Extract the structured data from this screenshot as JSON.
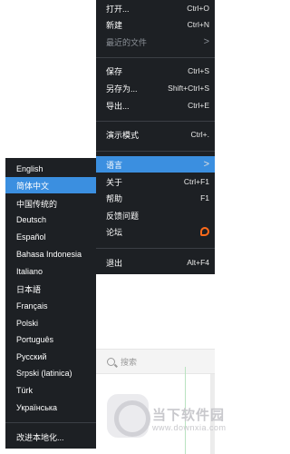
{
  "menu": {
    "items": [
      {
        "label": "打开...",
        "shortcut": "Ctrl+O"
      },
      {
        "label": "新建",
        "shortcut": "Ctrl+N"
      },
      {
        "label": "最近的文件",
        "shortcut": ">"
      },
      {
        "label": "保存",
        "shortcut": "Ctrl+S"
      },
      {
        "label": "另存为...",
        "shortcut": "Shift+Ctrl+S"
      },
      {
        "label": "导出...",
        "shortcut": "Ctrl+E"
      },
      {
        "label": "演示模式",
        "shortcut": "Ctrl+."
      },
      {
        "label": "语言",
        "shortcut": ">"
      },
      {
        "label": "关于",
        "shortcut": "Ctrl+F1"
      },
      {
        "label": "帮助",
        "shortcut": "F1"
      },
      {
        "label": "反馈问题",
        "shortcut": ""
      },
      {
        "label": "论坛",
        "shortcut": ""
      },
      {
        "label": "退出",
        "shortcut": "Alt+F4"
      }
    ]
  },
  "languages": {
    "items": [
      "English",
      "简体中文",
      "中国传统的",
      "Deutsch",
      "Español",
      "Bahasa Indonesia",
      "Italiano",
      "日本語",
      "Français",
      "Polski",
      "Português",
      "Русский",
      "Srpski (latinica)",
      "Türk",
      "Українська"
    ],
    "improve": "改进本地化..."
  },
  "search": {
    "placeholder": "搜索"
  },
  "watermark": {
    "title": "当下软件园",
    "url": "www.downxia.com"
  },
  "colors": {
    "menu_bg": "#1d2024",
    "highlight": "#3b8fe0",
    "forum_icon": "#ff6a1a"
  }
}
